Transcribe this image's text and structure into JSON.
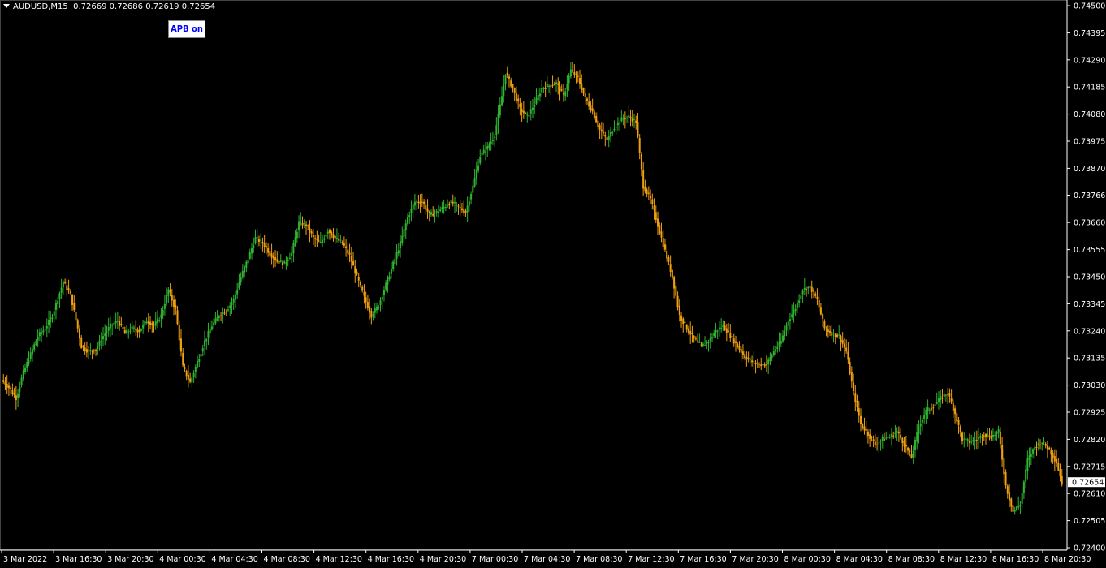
{
  "header": {
    "symbol": "AUDUSD,M15",
    "ohlc": "0.72669 0.72686 0.72619 0.72654"
  },
  "apb_button": {
    "label": "APB on"
  },
  "colors": {
    "background": "#000000",
    "grid": "#1b1b1b",
    "axis_text": "#ffffff",
    "bull": "#2fb52f",
    "bear": "#f0a010",
    "price_tag_bg": "#ffffff",
    "price_tag_text": "#000000"
  },
  "chart_data": {
    "type": "candlestick",
    "y_ticks": [
      "0.74500",
      "0.74395",
      "0.74290",
      "0.74185",
      "0.74080",
      "0.73975",
      "0.73870",
      "0.73766",
      "0.73660",
      "0.73555",
      "0.73450",
      "0.73345",
      "0.73240",
      "0.73135",
      "0.73030",
      "0.72925",
      "0.72820",
      "0.72715",
      "0.72610",
      "0.72505",
      "0.72400"
    ],
    "ylim": [
      0.724,
      0.745
    ],
    "x_ticks": [
      "3 Mar 2022",
      "3 Mar 16:30",
      "3 Mar 20:30",
      "4 Mar 00:30",
      "4 Mar 04:30",
      "4 Mar 08:30",
      "4 Mar 12:30",
      "4 Mar 16:30",
      "4 Mar 20:30",
      "7 Mar 00:30",
      "7 Mar 04:30",
      "7 Mar 08:30",
      "7 Mar 12:30",
      "7 Mar 16:30",
      "7 Mar 20:30",
      "8 Mar 00:30",
      "8 Mar 04:30",
      "8 Mar 08:30",
      "8 Mar 12:30",
      "8 Mar 16:30",
      "8 Mar 20:30"
    ],
    "current_price": "0.72654",
    "close_path": [
      [
        0,
        0.7305
      ],
      [
        4,
        0.7302
      ],
      [
        8,
        0.7298
      ],
      [
        12,
        0.7308
      ],
      [
        16,
        0.7315
      ],
      [
        20,
        0.7322
      ],
      [
        24,
        0.7325
      ],
      [
        28,
        0.733
      ],
      [
        34,
        0.7343
      ],
      [
        38,
        0.7338
      ],
      [
        42,
        0.7325
      ],
      [
        44,
        0.7318
      ],
      [
        48,
        0.7316
      ],
      [
        52,
        0.7317
      ],
      [
        56,
        0.7322
      ],
      [
        60,
        0.7326
      ],
      [
        64,
        0.7328
      ],
      [
        68,
        0.7323
      ],
      [
        72,
        0.7325
      ],
      [
        76,
        0.7324
      ],
      [
        80,
        0.7328
      ],
      [
        84,
        0.7326
      ],
      [
        88,
        0.733
      ],
      [
        92,
        0.734
      ],
      [
        96,
        0.7332
      ],
      [
        100,
        0.731
      ],
      [
        104,
        0.7304
      ],
      [
        108,
        0.7312
      ],
      [
        112,
        0.732
      ],
      [
        116,
        0.7326
      ],
      [
        120,
        0.733
      ],
      [
        124,
        0.7332
      ],
      [
        128,
        0.7336
      ],
      [
        132,
        0.7345
      ],
      [
        136,
        0.7352
      ],
      [
        140,
        0.736
      ],
      [
        144,
        0.7358
      ],
      [
        148,
        0.7354
      ],
      [
        152,
        0.7351
      ],
      [
        156,
        0.735
      ],
      [
        160,
        0.7354
      ],
      [
        164,
        0.7366
      ],
      [
        168,
        0.7365
      ],
      [
        172,
        0.736
      ],
      [
        176,
        0.7358
      ],
      [
        180,
        0.7363
      ],
      [
        184,
        0.736
      ],
      [
        188,
        0.7358
      ],
      [
        192,
        0.7353
      ],
      [
        196,
        0.7345
      ],
      [
        200,
        0.7337
      ],
      [
        204,
        0.733
      ],
      [
        208,
        0.7334
      ],
      [
        212,
        0.7342
      ],
      [
        216,
        0.735
      ],
      [
        220,
        0.7358
      ],
      [
        224,
        0.7368
      ],
      [
        228,
        0.7374
      ],
      [
        232,
        0.7374
      ],
      [
        236,
        0.7369
      ],
      [
        240,
        0.737
      ],
      [
        244,
        0.7372
      ],
      [
        248,
        0.7374
      ],
      [
        252,
        0.7372
      ],
      [
        256,
        0.737
      ],
      [
        260,
        0.738
      ],
      [
        264,
        0.7392
      ],
      [
        268,
        0.7395
      ],
      [
        272,
        0.74
      ],
      [
        276,
        0.7415
      ],
      [
        278,
        0.7424
      ],
      [
        282,
        0.7418
      ],
      [
        286,
        0.741
      ],
      [
        290,
        0.7407
      ],
      [
        294,
        0.7412
      ],
      [
        298,
        0.7418
      ],
      [
        302,
        0.7419
      ],
      [
        306,
        0.742
      ],
      [
        310,
        0.7415
      ],
      [
        314,
        0.7425
      ],
      [
        318,
        0.7422
      ],
      [
        322,
        0.7414
      ],
      [
        326,
        0.7409
      ],
      [
        330,
        0.7402
      ],
      [
        334,
        0.7398
      ],
      [
        338,
        0.7403
      ],
      [
        342,
        0.7406
      ],
      [
        346,
        0.7407
      ],
      [
        350,
        0.7405
      ],
      [
        354,
        0.738
      ],
      [
        358,
        0.7375
      ],
      [
        362,
        0.7365
      ],
      [
        366,
        0.7355
      ],
      [
        370,
        0.7345
      ],
      [
        374,
        0.733
      ],
      [
        378,
        0.7325
      ],
      [
        382,
        0.7321
      ],
      [
        386,
        0.7318
      ],
      [
        390,
        0.732
      ],
      [
        394,
        0.7324
      ],
      [
        398,
        0.7326
      ],
      [
        402,
        0.7322
      ],
      [
        406,
        0.7318
      ],
      [
        410,
        0.7314
      ],
      [
        414,
        0.7312
      ],
      [
        418,
        0.7311
      ],
      [
        422,
        0.7311
      ],
      [
        426,
        0.7316
      ],
      [
        430,
        0.732
      ],
      [
        434,
        0.7328
      ],
      [
        438,
        0.7333
      ],
      [
        442,
        0.734
      ],
      [
        446,
        0.7341
      ],
      [
        450,
        0.7336
      ],
      [
        454,
        0.7325
      ],
      [
        458,
        0.7323
      ],
      [
        462,
        0.7322
      ],
      [
        466,
        0.7316
      ],
      [
        470,
        0.73
      ],
      [
        474,
        0.7288
      ],
      [
        478,
        0.7284
      ],
      [
        482,
        0.728
      ],
      [
        486,
        0.7282
      ],
      [
        490,
        0.7283
      ],
      [
        494,
        0.7285
      ],
      [
        498,
        0.728
      ],
      [
        502,
        0.7275
      ],
      [
        506,
        0.7287
      ],
      [
        510,
        0.7293
      ],
      [
        514,
        0.7295
      ],
      [
        518,
        0.7298
      ],
      [
        522,
        0.73
      ],
      [
        526,
        0.7292
      ],
      [
        530,
        0.7282
      ],
      [
        534,
        0.7281
      ],
      [
        538,
        0.7282
      ],
      [
        542,
        0.7284
      ],
      [
        546,
        0.7283
      ],
      [
        550,
        0.7285
      ],
      [
        554,
        0.7264
      ],
      [
        558,
        0.7254
      ],
      [
        562,
        0.7257
      ],
      [
        566,
        0.7274
      ],
      [
        570,
        0.7279
      ],
      [
        574,
        0.7281
      ],
      [
        578,
        0.7278
      ],
      [
        582,
        0.7273
      ],
      [
        585,
        0.7265
      ]
    ]
  }
}
